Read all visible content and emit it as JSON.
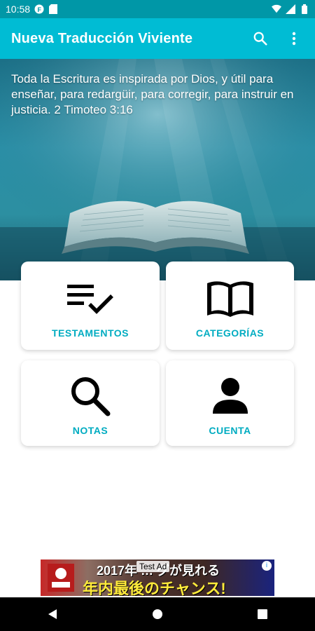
{
  "status_bar": {
    "time": "10:58"
  },
  "app_bar": {
    "title": "Nueva Traducción Viviente"
  },
  "hero": {
    "verse": "Toda la Escritura es inspirada por Dios, y útil para enseñar, para redargüir, para corregir, para instruir en justicia. 2 Timoteo 3:16"
  },
  "menu": {
    "testamentos": "TESTAMENTOS",
    "categorias": "CATEGORÍAS",
    "notas": "NOTAS",
    "cuenta": "CUENTA"
  },
  "ad": {
    "badge": "Test Ad",
    "line1": "2017年 … グが見れる",
    "line2": "年内最後のチャンス!"
  },
  "colors": {
    "primary": "#00bcd4",
    "primary_dark": "#0097a7",
    "label": "#00acc1"
  },
  "icons": [
    "search-icon",
    "more-vert-icon",
    "playlist-check-icon",
    "book-open-icon",
    "magnifier-icon",
    "person-icon"
  ]
}
